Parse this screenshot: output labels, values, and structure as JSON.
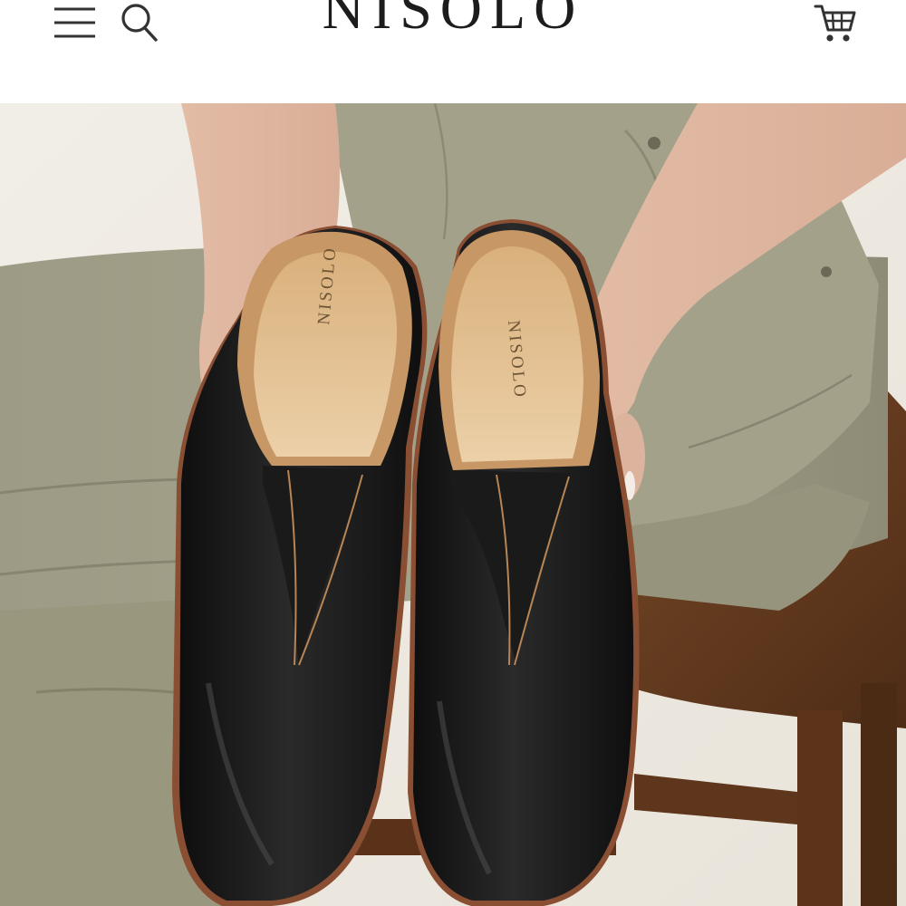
{
  "header": {
    "brand": "NISOLO",
    "icons": {
      "menu": "hamburger-menu-icon",
      "search": "search-icon",
      "cart": "shopping-cart-icon"
    }
  },
  "hero": {
    "image_subject": "",
    "insole_brand_left": "NISOLO",
    "insole_brand_right": "NISOLO"
  },
  "colors": {
    "text": "#1c1c1c",
    "background": "#ffffff",
    "pants": "#9c9a83",
    "leather": "#151515",
    "insole": "#e2bf8f",
    "stool": "#6a3f22"
  }
}
